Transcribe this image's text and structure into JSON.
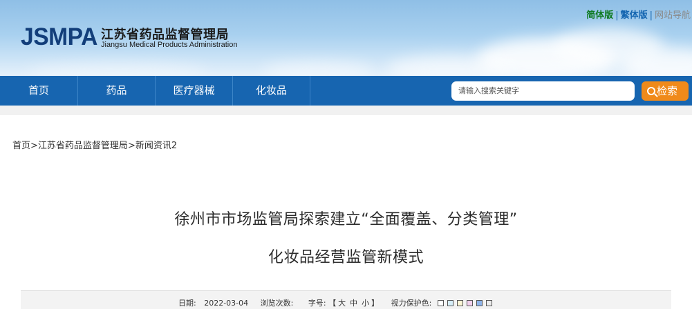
{
  "header": {
    "logo": "JSMPA",
    "title_cn": "江苏省药品监督管理局",
    "title_en": "Jiangsu Medical Products Administration",
    "links": {
      "simplified": "简体版",
      "traditional": "繁体版",
      "sitemap": "网站导航",
      "sep": "|"
    }
  },
  "nav": {
    "items": [
      {
        "label": "首页"
      },
      {
        "label": "药品"
      },
      {
        "label": "医疗器械"
      },
      {
        "label": "化妆品"
      }
    ],
    "search": {
      "placeholder": "请输入搜索关键字",
      "button": "检索"
    }
  },
  "breadcrumb": {
    "home": "首页",
    "bureau": "江苏省药品监督管理局",
    "section": "新闻资讯2",
    "sep": ">"
  },
  "article": {
    "title_line1": "徐州市市场监管局探索建立“全面覆盖、分类管理”",
    "title_line2": "化妆品经营监管新模式",
    "meta": {
      "date_label": "日期:",
      "date": "2022-03-04",
      "views_label": "浏览次数:",
      "font_label": "字号:",
      "bracket_open": "【",
      "font_large": "大",
      "font_medium": "中",
      "font_small": "小",
      "bracket_close": "】",
      "eye_label": "视力保护色:",
      "eye_colors": [
        "#ffffff",
        "#d6eef8",
        "#fbf6d6",
        "#f3d2ee",
        "#8fb4ea",
        "#ececec"
      ]
    }
  }
}
